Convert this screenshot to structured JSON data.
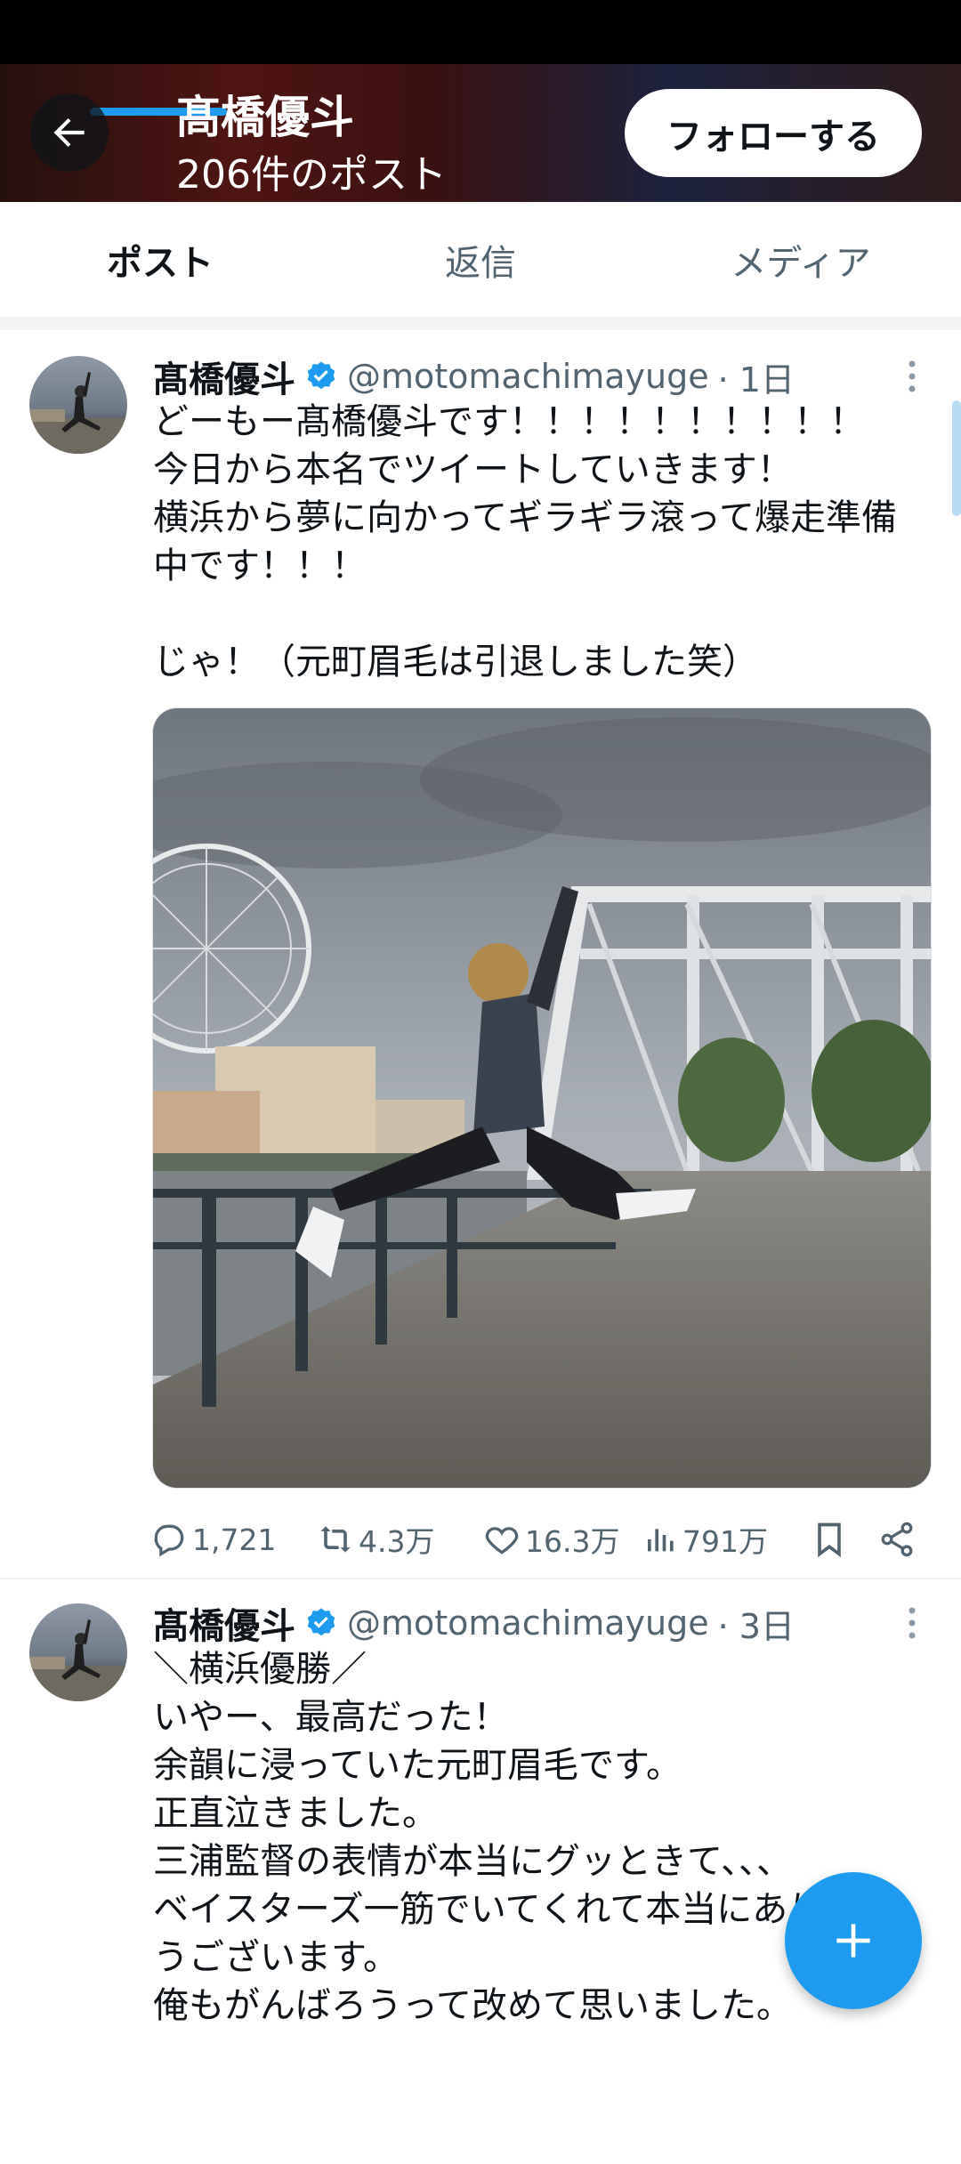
{
  "header": {
    "title": "髙橋優斗",
    "subtitle": "206件のポスト",
    "follow_label": "フォローする"
  },
  "tabs": [
    {
      "label": "ポスト",
      "active": true
    },
    {
      "label": "返信",
      "active": false
    },
    {
      "label": "メディア",
      "active": false
    }
  ],
  "posts": [
    {
      "name": "髙橋優斗",
      "handle": "@motomachimayuge",
      "time": "· 1日",
      "text": "どーもー髙橋優斗です！！！！！！！！！！\n今日から本名でツイートしていきます！\n横浜から夢に向かってギラギラ滾って爆走準備\n中です！！！\n\nじゃ！（元町眉毛は引退しました笑）",
      "replies": "1,721",
      "reposts": "4.3万",
      "likes": "16.3万",
      "views": "791万"
    },
    {
      "name": "髙橋優斗",
      "handle": "@motomachimayuge",
      "time": "· 3日",
      "text": "＼横浜優勝／\nいやー、最高だった！\n余韻に浸っていた元町眉毛です。\n正直泣きました。\n三浦監督の表情が本当にグッときて、、、\nベイスターズ一筋でいてくれて本当にありがと\nうございます。\n俺もがんばろうって改めて思いました。"
    }
  ],
  "colors": {
    "accent": "#1d9bf0",
    "text": "#0f1419",
    "secondary": "#536471"
  },
  "icons": [
    "arrow-left-icon",
    "verified-badge-icon",
    "more-icon",
    "reply-icon",
    "repost-icon",
    "like-icon",
    "views-icon",
    "bookmark-icon",
    "share-icon",
    "plus-icon"
  ]
}
